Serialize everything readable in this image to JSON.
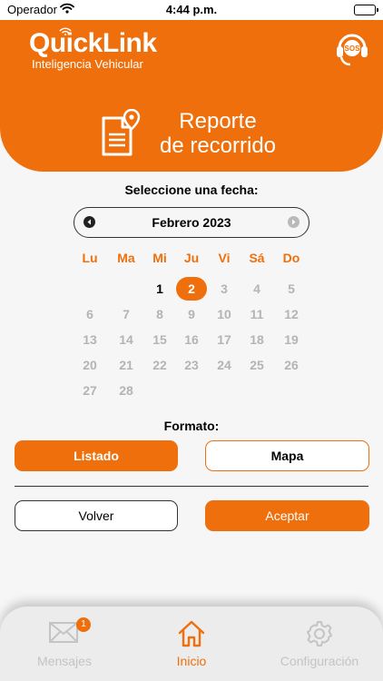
{
  "status_bar": {
    "carrier": "Operador",
    "time": "4:44 p.m."
  },
  "brand": {
    "name": "QuickLink",
    "tagline": "Inteligencia Vehicular",
    "sos_label": "SOS",
    "color": "#ee6f0b"
  },
  "hero": {
    "title_line1": "Reporte",
    "title_line2": "de recorrido"
  },
  "date_picker": {
    "label": "Seleccione una fecha:",
    "month": "Febrero 2023",
    "weekdays": [
      "Lu",
      "Ma",
      "Mi",
      "Ju",
      "Vi",
      "Sá",
      "Do"
    ],
    "first_weekday_index": 2,
    "days_in_month": 28,
    "enabled_days": [
      1,
      2
    ],
    "selected_day": 2
  },
  "format": {
    "label": "Formato:",
    "options": [
      "Listado",
      "Mapa"
    ],
    "selected": "Listado"
  },
  "actions": {
    "back_label": "Volver",
    "accept_label": "Aceptar"
  },
  "tabs": [
    {
      "label": "Mensajes",
      "icon": "envelope-icon",
      "badge": "1",
      "active": false
    },
    {
      "label": "Inicio",
      "icon": "home-icon",
      "active": true
    },
    {
      "label": "Configuración",
      "icon": "gear-icon",
      "active": false
    }
  ]
}
